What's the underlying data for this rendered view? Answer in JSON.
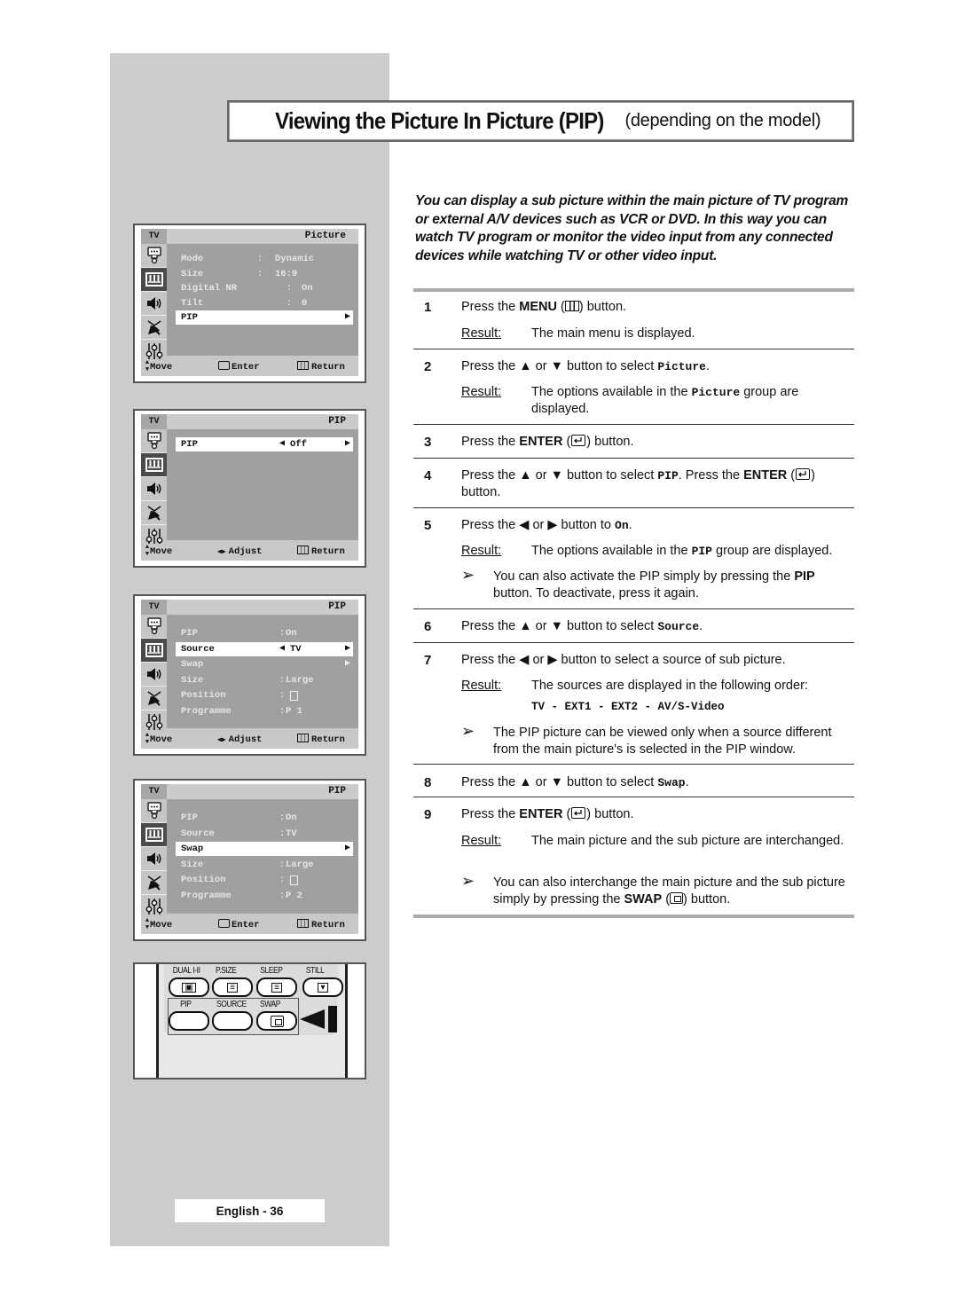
{
  "title": {
    "main": "Viewing the Picture In Picture (PIP)",
    "sub": "(depending on the model)"
  },
  "intro": "You can display a sub picture within the main picture of TV program or external A/V devices such as VCR or DVD. In this way you can watch TV program or monitor the video input from any connected devices while watching TV or other video input.",
  "osd_common": {
    "tv_tab": "TV",
    "sidebar_icons": [
      "input-plug-icon",
      "picture-icon",
      "sound-icon",
      "channel-antenna-icon",
      "setup-sliders-icon"
    ],
    "selected_icon_index": 1
  },
  "osd_screens": [
    {
      "title": "Picture",
      "rows": [
        {
          "label": "Mode",
          "sep": ":",
          "value": "Dynamic",
          "highlight": false
        },
        {
          "label": "Size",
          "sep": ":",
          "value": "16:9",
          "highlight": false
        },
        {
          "label": "Digital NR",
          "sep": ":",
          "value": "On",
          "highlight": false
        },
        {
          "label": "Tilt",
          "sep": ":",
          "value": "0",
          "highlight": false
        },
        {
          "label": "PIP",
          "sep": "",
          "value": "",
          "highlight": true,
          "arrow": "▶"
        }
      ],
      "footer": {
        "move": "Move",
        "action": "Enter",
        "return": "Return"
      }
    },
    {
      "title": "PIP",
      "rows": [
        {
          "label": "PIP",
          "sep": "◀",
          "value": "Off",
          "highlight": true,
          "arrow": "▶"
        }
      ],
      "footer": {
        "move": "Move",
        "action": "Adjust",
        "return": "Return"
      }
    },
    {
      "title": "PIP",
      "rows": [
        {
          "label": "PIP",
          "sep": ":",
          "value": "On",
          "highlight": false
        },
        {
          "label": "Source",
          "sep": "◀",
          "value": "TV",
          "highlight": true,
          "arrow": "▶"
        },
        {
          "label": "Swap",
          "sep": "",
          "value": "",
          "highlight": false,
          "arrow": "▶"
        },
        {
          "label": "Size",
          "sep": ":",
          "value": "Large",
          "highlight": false
        },
        {
          "label": "Position",
          "sep": ":",
          "value": "",
          "highlight": false,
          "position_icon": true
        },
        {
          "label": "Programme",
          "sep": ":",
          "value": "P 1",
          "highlight": false
        }
      ],
      "footer": {
        "move": "Move",
        "action": "Adjust",
        "return": "Return"
      }
    },
    {
      "title": "PIP",
      "rows": [
        {
          "label": "PIP",
          "sep": ":",
          "value": "On",
          "highlight": false
        },
        {
          "label": "Source",
          "sep": ":",
          "value": "TV",
          "highlight": false
        },
        {
          "label": "Swap",
          "sep": "",
          "value": "",
          "highlight": true,
          "arrow": "▶"
        },
        {
          "label": "Size",
          "sep": ":",
          "value": "Large",
          "highlight": false
        },
        {
          "label": "Position",
          "sep": ":",
          "value": "",
          "highlight": false,
          "position_icon": true
        },
        {
          "label": "Programme",
          "sep": ":",
          "value": "P 2",
          "highlight": false
        }
      ],
      "footer": {
        "move": "Move",
        "action": "Enter",
        "return": "Return"
      }
    }
  ],
  "remote": {
    "top_labels": [
      "DUAL I-II",
      "P.SIZE",
      "SLEEP",
      "STILL"
    ],
    "bottom_labels": [
      "PIP",
      "SOURCE",
      "SWAP"
    ]
  },
  "steps": [
    {
      "num": "1",
      "parts": [
        "Press the ",
        {
          "b": "MENU"
        },
        " (",
        {
          "icon": "menu"
        },
        ") button."
      ],
      "result": "The main menu is displayed."
    },
    {
      "num": "2",
      "parts": [
        "Press the ▲ or ▼ button to select ",
        {
          "m": "Picture"
        },
        "."
      ],
      "result_parts": [
        "The options available in the ",
        {
          "m": "Picture"
        },
        " group are displayed."
      ]
    },
    {
      "num": "3",
      "parts": [
        "Press the ",
        {
          "b": "ENTER"
        },
        " (",
        {
          "icon": "enter"
        },
        ") button."
      ]
    },
    {
      "num": "4",
      "parts": [
        "Press the ▲ or ▼  button to select ",
        {
          "m": "PIP"
        },
        ". Press the ",
        {
          "b": "ENTER"
        },
        " (",
        {
          "icon": "enter"
        },
        ") button."
      ]
    },
    {
      "num": "5",
      "parts": [
        "Press the ◀ or ▶ button to ",
        {
          "m": "On"
        },
        "."
      ],
      "result_parts": [
        "The options available in the ",
        {
          "m": "PIP"
        },
        " group are displayed."
      ],
      "note_parts": [
        "You can also activate the PIP simply by pressing the ",
        {
          "b": "PIP"
        },
        " button. To deactivate, press it again."
      ]
    },
    {
      "num": "6",
      "parts": [
        "Press the ▲ or ▼ button to select ",
        {
          "m": "Source"
        },
        "."
      ]
    },
    {
      "num": "7",
      "parts": [
        "Press the ◀ or ▶ button to select a source of sub picture."
      ],
      "result": "The sources are displayed in the following order:",
      "result_extra": "TV - EXT1 - EXT2 - AV/S-Video",
      "note": "The PIP picture can be viewed only when a source different from the main picture's is selected in the PIP window."
    },
    {
      "num": "8",
      "parts": [
        "Press the ▲ or ▼ button to select ",
        {
          "m": "Swap"
        },
        "."
      ]
    },
    {
      "num": "9",
      "parts": [
        "Press the ",
        {
          "b": "ENTER"
        },
        " (",
        {
          "icon": "enter"
        },
        ") button."
      ],
      "result": "The main picture and the sub picture are interchanged.",
      "note_parts": [
        "You can also interchange the main picture and the sub picture simply by pressing the ",
        {
          "b": "SWAP"
        },
        " (",
        {
          "icon": "swap"
        },
        ") button."
      ]
    }
  ],
  "result_label": "Result:",
  "note_arrow": "➢",
  "page_label": "English - 36"
}
